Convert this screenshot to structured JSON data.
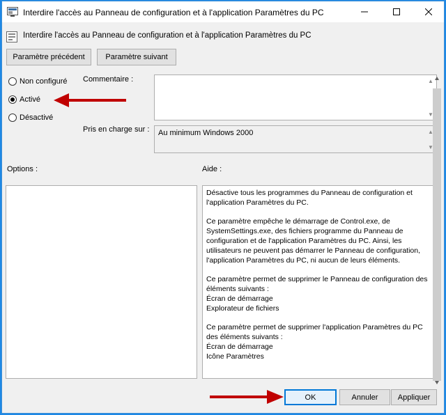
{
  "window": {
    "title": "Interdire l'accès au Panneau de configuration et à l'application Paramètres du PC"
  },
  "header": {
    "policy_name": "Interdire l'accès au Panneau de configuration et à l'application Paramètres du PC"
  },
  "nav": {
    "prev_label": "Paramètre précédent",
    "next_label": "Paramètre suivant"
  },
  "state": {
    "options": [
      {
        "label": "Non configuré",
        "selected": false
      },
      {
        "label": "Activé",
        "selected": true
      },
      {
        "label": "Désactivé",
        "selected": false
      }
    ]
  },
  "comment": {
    "label": "Commentaire :",
    "value": ""
  },
  "supported": {
    "label": "Pris en charge sur :",
    "value": "Au minimum Windows 2000"
  },
  "options_pane": {
    "label": "Options :"
  },
  "help_pane": {
    "label": "Aide :",
    "paragraphs": [
      "Désactive tous les programmes du Panneau de configuration et l'application Paramètres du PC.",
      "Ce paramètre empêche le démarrage de Control.exe, de SystemSettings.exe, des fichiers programme du Panneau de configuration et de l'application Paramètres du PC. Ainsi, les utilisateurs ne peuvent pas démarrer le Panneau de configuration, l'application Paramètres du PC, ni aucun de leurs éléments.",
      "Ce paramètre permet de supprimer le Panneau de configuration des éléments suivants :\nÉcran de démarrage\nExplorateur de fichiers",
      "Ce paramètre permet de supprimer l'application Paramètres du PC des éléments suivants :\nÉcran de démarrage\nIcône Paramètres"
    ]
  },
  "footer": {
    "ok_label": "OK",
    "cancel_label": "Annuler",
    "apply_label": "Appliquer"
  },
  "colors": {
    "annotation_arrow": "#c00000",
    "accent": "#0078d7"
  }
}
